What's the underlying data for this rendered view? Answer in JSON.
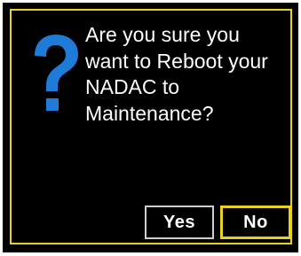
{
  "dialog": {
    "message": "Are you sure you\nwant to Reboot your\nNADAC to\nMaintenance?",
    "icon": "question-mark-icon",
    "buttons": {
      "yes_label": "Yes",
      "no_label": "No"
    },
    "focused_button": "No"
  },
  "colors": {
    "background": "#000000",
    "focus_border": "#e8d21a",
    "icon": "#1e7bd8",
    "text": "#ffffff"
  }
}
